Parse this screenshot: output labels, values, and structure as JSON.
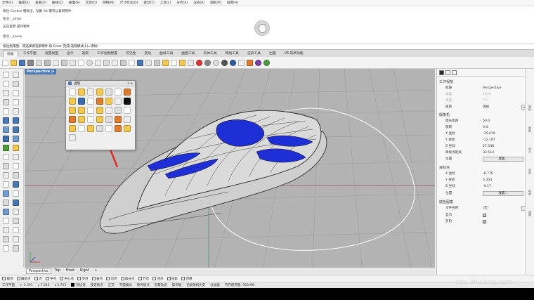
{
  "menu": [
    "文件(F)",
    "编辑(E)",
    "查看(V)",
    "曲线(C)",
    "曲面(S)",
    "实体(O)",
    "网格(M)",
    "尺寸标注(D)",
    "变动(T)",
    "工具(L)",
    "分析(A)",
    "渲染(R)",
    "面板(P)",
    "说明(H)"
  ],
  "command_history": [
    "按住 Control 键拆出、钻眼 Alt 键可以复制物件",
    "指令: _Undo",
    "正在复原 操作物件",
    "指令: _Lasso"
  ],
  "command_prompt": "按住拖曳圈、或选择要选取物件 按 Enter 完成(选取模式(L)=添加)",
  "tabs": [
    "标准",
    "工作平面",
    "设置视图",
    "显示",
    "选取",
    "工作视窗配置",
    "可见性",
    "变动",
    "曲线工具",
    "曲面工具",
    "实体工具",
    "网格工具",
    "渲染工具",
    "出图",
    "V6 的新功能"
  ],
  "active_tab": "标准",
  "viewport": {
    "title": "Perspective",
    "title_arrow": "|▾"
  },
  "float_panel": {
    "title": "选取",
    "close": "× ▸"
  },
  "view_tabs": [
    "Perspective",
    "Top",
    "Front",
    "Right",
    "+"
  ],
  "osnap": [
    "端点",
    "最近点",
    "点",
    "中点",
    "中心点",
    "交点",
    "垂点",
    "切点",
    "四分点",
    "节点",
    "顶点",
    "投影",
    "停用"
  ],
  "status": {
    "plane": "工作平面",
    "x": "x -3.391",
    "y": "y 7.043",
    "z": "z 2.723",
    "layer": "预设值",
    "items": [
      "锁定格点",
      "正交",
      "平面模式",
      "物件锁点",
      "智慧轨迹",
      "操作轴",
      "记录建构历史",
      "过滤器",
      "内存使用量: 958 MB"
    ]
  },
  "right_panel": {
    "section_viewport": "工作视窗",
    "title_label": "标题",
    "title_value": "Perspective",
    "width_label": "宽度",
    "width_value": "1476",
    "height_label": "高度",
    "height_value": "711",
    "proj_label": "投影",
    "proj_value": "透视",
    "section_camera": "摄像机",
    "lens_label": "镜头焦距",
    "lens_value": "50.0",
    "rot_label": "旋转",
    "rot_value": "0.0",
    "cx_label": "X 坐标",
    "cx_value": "-15.619",
    "cy_label": "Y 坐标",
    "cy_value": "-12.197",
    "cz_label": "Z 坐标",
    "cz_value": "27.548",
    "dist_label": "目标点距离",
    "dist_value": "33.514",
    "pos_label": "位置",
    "place_btn": "放置...",
    "section_target": "目标点",
    "tx_label": "X 坐标",
    "tx_value": "-8.776",
    "ty_label": "Y 坐标",
    "ty_value": "5.354",
    "tz_label": "Z 坐标",
    "tz_value": "-0.17",
    "tpos_label": "位置",
    "tplace_btn": "放置...",
    "section_wallpaper": "底色图案",
    "file_label": "文件名称",
    "file_value": "(无)",
    "show_label": "显示",
    "gray_label": "灰阶",
    "dots": "...",
    "check": "☑"
  },
  "side_strip": [
    "属性",
    "图层",
    "显示",
    "渲染",
    "材质",
    "说明"
  ],
  "watermark": "edu.zhulong.com",
  "colors": {
    "viewport_bg": "#b3b3b3",
    "highlight_blue": "#1f2fd6",
    "accent": "#4a78b5",
    "arrow_red": "#e8261f"
  }
}
